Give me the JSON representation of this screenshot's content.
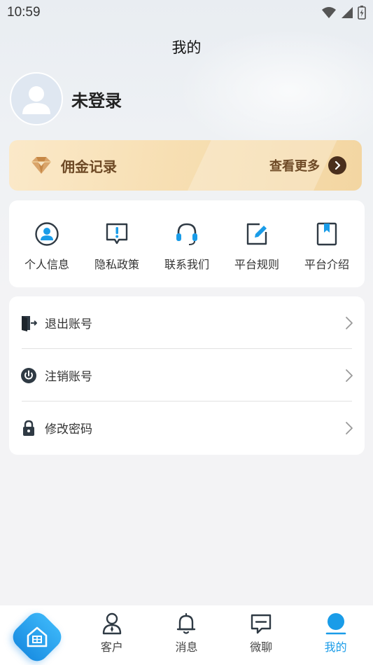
{
  "status_bar": {
    "time": "10:59"
  },
  "header": {
    "title": "我的"
  },
  "profile": {
    "name": "未登录"
  },
  "commission": {
    "title": "佣金记录",
    "more_label": "查看更多"
  },
  "quick_actions": [
    {
      "label": "个人信息",
      "icon": "user-circle-icon"
    },
    {
      "label": "隐私政策",
      "icon": "exclamation-chat-icon"
    },
    {
      "label": "联系我们",
      "icon": "headset-icon"
    },
    {
      "label": "平台规则",
      "icon": "edit-note-icon"
    },
    {
      "label": "平台介绍",
      "icon": "bookmark-icon"
    }
  ],
  "menu": [
    {
      "label": "退出账号",
      "icon": "exit-door-icon"
    },
    {
      "label": "注销账号",
      "icon": "power-icon"
    },
    {
      "label": "修改密码",
      "icon": "lock-icon"
    }
  ],
  "tabbar": [
    {
      "label": "",
      "icon": "home-icon"
    },
    {
      "label": "客户",
      "icon": "customer-icon"
    },
    {
      "label": "消息",
      "icon": "bell-icon"
    },
    {
      "label": "微聊",
      "icon": "chat-icon"
    },
    {
      "label": "我的",
      "icon": "profile-icon",
      "active": true
    }
  ],
  "colors": {
    "accent": "#1a9ce8",
    "commission_text": "#6e4a26",
    "icon_dark": "#2f3a44",
    "icon_blue": "#1a9ce8"
  }
}
